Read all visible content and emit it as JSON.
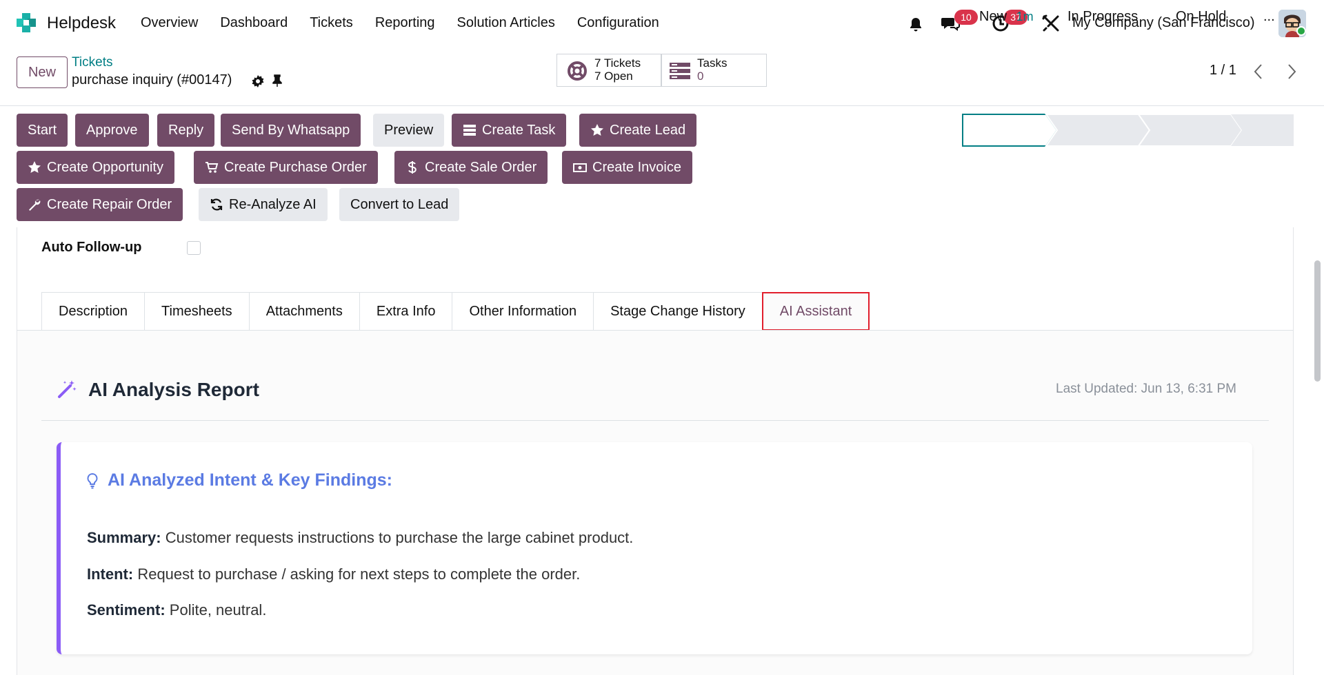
{
  "nav": {
    "app_name": "Helpdesk",
    "menu": [
      "Overview",
      "Dashboard",
      "Tickets",
      "Reporting",
      "Solution Articles",
      "Configuration"
    ],
    "messages_count": "10",
    "activities_count": "37",
    "company": "My Company (San Francisco)"
  },
  "control": {
    "new_label": "New",
    "breadcrumb_parent": "Tickets",
    "record_title": "purchase inquiry (#00147)",
    "tickets_stat_line1": "7 Tickets",
    "tickets_stat_line2": "7 Open",
    "tasks_stat_label": "Tasks",
    "tasks_stat_value": "0",
    "pager": "1 / 1"
  },
  "actions": {
    "start": "Start",
    "approve": "Approve",
    "reply": "Reply",
    "whatsapp": "Send By Whatsapp",
    "preview": "Preview",
    "create_task": "Create Task",
    "create_lead": "Create Lead",
    "create_opportunity": "Create Opportunity",
    "create_po": "Create Purchase Order",
    "create_so": "Create Sale Order",
    "create_invoice": "Create Invoice",
    "create_repair": "Create Repair Order",
    "reanalyze": "Re-Analyze AI",
    "convert_lead": "Convert to Lead"
  },
  "status": {
    "new": "New",
    "new_duration": "1m",
    "in_progress": "In Progress",
    "on_hold": "On Hold",
    "more": "..."
  },
  "form": {
    "auto_followup_label": "Auto Follow-up",
    "auto_followup_value": false,
    "tabs": [
      "Description",
      "Timesheets",
      "Attachments",
      "Extra Info",
      "Other Information",
      "Stage Change History",
      "AI Assistant"
    ],
    "active_tab": "AI Assistant"
  },
  "report": {
    "title": "AI Analysis Report",
    "last_updated": "Last Updated: Jun 13, 6:31 PM",
    "findings_title": "AI Analyzed Intent & Key Findings:",
    "summary_label": "Summary:",
    "summary_text": " Customer requests instructions to purchase the large cabinet product.",
    "intent_label": "Intent:",
    "intent_text": " Request to purchase / asking for next steps to complete the order.",
    "sentiment_label": "Sentiment:",
    "sentiment_text": " Polite, neutral."
  },
  "colors": {
    "primary": "#714b67",
    "teal": "#017e84",
    "badge": "#d9334b",
    "accent_purple": "#8b5cf6",
    "findings_blue": "#5b7be3"
  }
}
